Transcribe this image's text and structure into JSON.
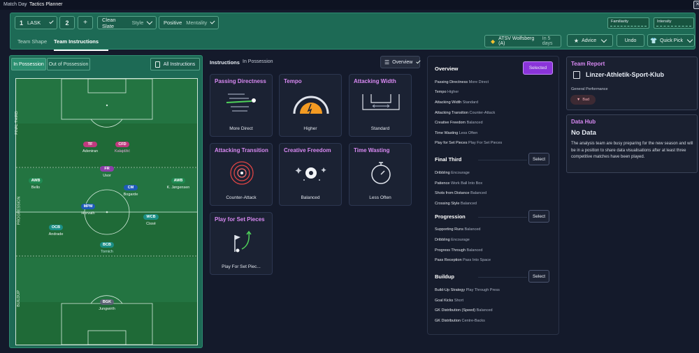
{
  "breadcrumb": {
    "parent": "Match Day",
    "current": "Tactics Planner"
  },
  "header": {
    "formation_number": "1",
    "formation_team": "LASK",
    "slot": "2",
    "add": "+",
    "style_name": "Clean Slate",
    "style_label": "Style",
    "mentality_name": "Positive",
    "mentality_label": "Mentality",
    "familiarity_label": "Familiarity",
    "intensity_label": "Intensity",
    "tabs": [
      "Team Shape",
      "Team Instructions"
    ],
    "next_match": "ATSV Wolfsberg (A)",
    "next_match_time": "In 5 days",
    "advice": "Advice",
    "undo": "Undo",
    "quick_pick": "Quick Pick"
  },
  "pitch": {
    "toggle_in": "In Possession",
    "toggle_out": "Out of Possession",
    "all_instructions": "All Instructions",
    "zones": [
      "FINAL THIRD",
      "PROGRESSION",
      "BUILDUP"
    ],
    "players": [
      {
        "pos": "TF",
        "name": "Adeniran",
        "color": "#c03a7e"
      },
      {
        "pos": "CFD",
        "name": "Kalajdžić",
        "color": "#c03a7e"
      },
      {
        "pos": "FR",
        "name": "Usor",
        "color": "#8b3fa8"
      },
      {
        "pos": "AWB",
        "name": "Bello",
        "color": "#1f8a52"
      },
      {
        "pos": "AWB",
        "name": "K. Jørgensen",
        "color": "#1f8a52"
      },
      {
        "pos": "CM",
        "name": "Bogarde",
        "color": "#1e5bb8"
      },
      {
        "pos": "MPM",
        "name": "Horvath",
        "color": "#1e5bb8"
      },
      {
        "pos": "WCB",
        "name": "Cissé",
        "color": "#1b8f86"
      },
      {
        "pos": "OCB",
        "name": "Andrade",
        "color": "#1b8f86"
      },
      {
        "pos": "BCB",
        "name": "Tornich",
        "color": "#1b8f86"
      },
      {
        "pos": "BGK",
        "name": "Jungwirth",
        "color": "#5c6475"
      }
    ]
  },
  "instructions": {
    "title": "Instructions",
    "subtitle": "In Possession",
    "view": "Overview",
    "cards": [
      {
        "title": "Passing Directness",
        "value": "More Direct"
      },
      {
        "title": "Tempo",
        "value": "Higher"
      },
      {
        "title": "Attacking Width",
        "value": "Standard"
      },
      {
        "title": "Attacking Transition",
        "value": "Counter-Attack"
      },
      {
        "title": "Creative Freedom",
        "value": "Balanced"
      },
      {
        "title": "Time Wasting",
        "value": "Less Often"
      },
      {
        "title": "Play for Set Pieces",
        "value": "Play For Set Piec..."
      }
    ]
  },
  "overview": {
    "title": "Overview",
    "selected_label": "Selected",
    "select_label": "Select",
    "general": [
      {
        "k": "Passing Directness",
        "v": "More Direct"
      },
      {
        "k": "Tempo",
        "v": "Higher"
      },
      {
        "k": "Attacking Width",
        "v": "Standard"
      },
      {
        "k": "Attacking Transition",
        "v": "Counter-Attack"
      },
      {
        "k": "Creative Freedom",
        "v": "Balanced"
      },
      {
        "k": "Time Wasting",
        "v": "Less Often"
      },
      {
        "k": "Play for Set Pieces",
        "v": "Play For Set Pieces"
      }
    ],
    "sections": [
      {
        "name": "Final Third",
        "rows": [
          {
            "k": "Dribbling",
            "v": "Encourage"
          },
          {
            "k": "Patience",
            "v": "Work Ball Into Box"
          },
          {
            "k": "Shots from Distance",
            "v": "Balanced"
          },
          {
            "k": "Crossing Style",
            "v": "Balanced"
          }
        ]
      },
      {
        "name": "Progression",
        "rows": [
          {
            "k": "Supporting Runs",
            "v": "Balanced"
          },
          {
            "k": "Dribbling",
            "v": "Encourage"
          },
          {
            "k": "Progress Through",
            "v": "Balanced"
          },
          {
            "k": "Pass Reception",
            "v": "Pass Into Space"
          }
        ]
      },
      {
        "name": "Buildup",
        "rows": [
          {
            "k": "Build-Up Strategy",
            "v": "Play Through Press"
          },
          {
            "k": "Goal Kicks",
            "v": "Short"
          },
          {
            "k": "GK Distribution (Speed)",
            "v": "Balanced"
          },
          {
            "k": "GK Distribution",
            "v": "Centre-Backs"
          }
        ]
      }
    ]
  },
  "team_report": {
    "title": "Team Report",
    "club": "Linzer-Athletik-Sport-Klub",
    "general_label": "General Performance",
    "badge": "Bad"
  },
  "data_hub": {
    "title": "Data Hub",
    "heading": "No Data",
    "body": "The analysis team are busy preparing for the new season and will be in a position to share data visualisations after at least three competitive matches have been played."
  }
}
